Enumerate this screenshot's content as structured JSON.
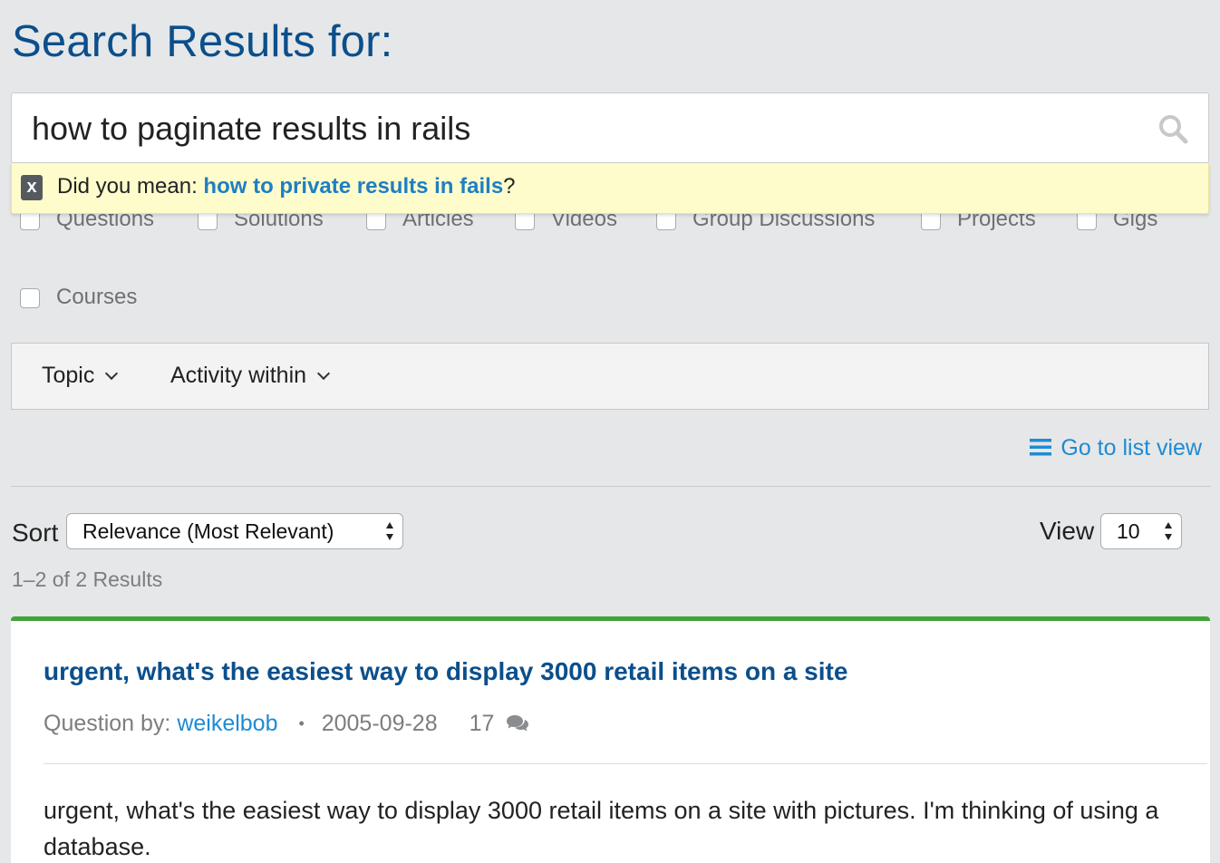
{
  "page": {
    "title": "Search Results for:"
  },
  "search": {
    "query": "how to paginate results in rails",
    "icon": "search-icon"
  },
  "suggestion": {
    "close_label": "x",
    "prefix": "Did you mean:",
    "suggested_query": "how to private results in fails",
    "suffix": "?"
  },
  "content_types": [
    {
      "label": "Questions",
      "checked": false
    },
    {
      "label": "Solutions",
      "checked": false
    },
    {
      "label": "Articles",
      "checked": false
    },
    {
      "label": "Videos",
      "checked": false
    },
    {
      "label": "Group Discussions",
      "checked": false
    },
    {
      "label": "Projects",
      "checked": false
    },
    {
      "label": "Gigs",
      "checked": false
    },
    {
      "label": "Courses",
      "checked": false
    }
  ],
  "filters": {
    "topic_label": "Topic",
    "activity_label": "Activity within"
  },
  "list_view": {
    "label": "Go to list view",
    "icon": "list-icon"
  },
  "controls": {
    "sort_label": "Sort",
    "sort_value": "Relevance (Most Relevant)",
    "view_label": "View",
    "view_value": "10"
  },
  "results_summary": "1–2 of 2 Results",
  "results": [
    {
      "title": "urgent, what's the easiest way to display 3000 retail items on a site",
      "type_prefix": "Question by:",
      "author": "weikelbob",
      "date": "2005-09-28",
      "comment_count": "17",
      "body": "urgent, what's the easiest way to display 3000 retail items on a site with pictures. I'm thinking of using a database."
    }
  ],
  "colors": {
    "title_blue": "#0b4f8c",
    "link_blue": "#1e8bd3",
    "suggest_bg": "#fffccc",
    "card_accent": "#3fa535",
    "page_bg": "#e6e7e8"
  }
}
